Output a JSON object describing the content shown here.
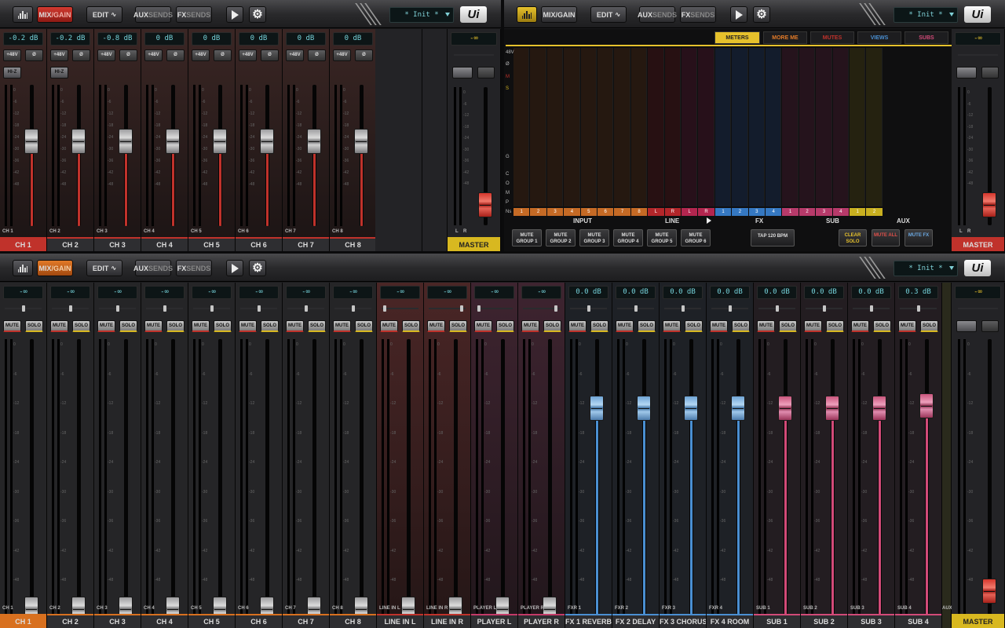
{
  "toolbar": {
    "mix_gain": [
      "MIX",
      "/GAIN"
    ],
    "edit": "EDIT",
    "aux": [
      "AUX",
      "SENDS"
    ],
    "fx": [
      "FX",
      "SENDS"
    ],
    "snapshot": "* Init *",
    "logo": "Ui"
  },
  "top_left": {
    "gains": [
      "-0.2 dB",
      "-0.2 dB",
      "-0.8 dB",
      "0 dB",
      "0 dB",
      "0 dB",
      "0 dB",
      "0 dB"
    ],
    "phantom": "+48V",
    "phase": "Ø",
    "hiz": "HI-Z",
    "channels": [
      "CH 1",
      "CH 2",
      "CH 3",
      "CH 4",
      "CH 5",
      "CH 6",
      "CH 7",
      "CH 8"
    ],
    "short": [
      "CH 1",
      "CH 2",
      "CH 3",
      "CH 4",
      "CH 5",
      "CH 6",
      "CH 7",
      "CH 8"
    ],
    "master": "MASTER",
    "master_value": "-∞",
    "lr": [
      "L",
      "R"
    ]
  },
  "scale_marks": [
    "0",
    "-6",
    "-12",
    "-18",
    "-24",
    "-30",
    "-36",
    "-42",
    "-48"
  ],
  "meters_view": {
    "tabs": [
      "METERS",
      "MORE ME",
      "MUTES",
      "VIEWS",
      "SUBS"
    ],
    "left_labels": [
      "48V",
      "Ø",
      "M",
      "S",
      "G",
      "C",
      "O",
      "M",
      "P",
      "Ns"
    ],
    "input_nums": [
      "1",
      "2",
      "3",
      "4",
      "5",
      "6",
      "7",
      "8"
    ],
    "line_nums": [
      "L",
      "R"
    ],
    "player_nums": [
      "L",
      "R"
    ],
    "fx_nums": [
      "1",
      "2",
      "3",
      "4"
    ],
    "sub_nums": [
      "1",
      "2",
      "3",
      "4"
    ],
    "aux_nums": [
      "1",
      "2"
    ],
    "group_labels": [
      "INPUT",
      "LINE",
      "FX",
      "SUB",
      "AUX"
    ],
    "mute_groups": [
      "MUTE GROUP 1",
      "MUTE GROUP 2",
      "MUTE GROUP 3",
      "MUTE GROUP 4",
      "MUTE GROUP 5",
      "MUTE GROUP 6"
    ],
    "tap": "TAP 120 BPM",
    "clear_solo": "CLEAR SOLO",
    "mute_all": "MUTE ALL",
    "mute_fx": "MUTE FX"
  },
  "bottom": {
    "channels": [
      {
        "name": "CH 1",
        "short": "CH 1",
        "value": "-∞",
        "kind": "input",
        "level": 0.0
      },
      {
        "name": "CH 2",
        "short": "CH 2",
        "value": "-∞",
        "kind": "input",
        "level": 0.0
      },
      {
        "name": "CH 3",
        "short": "CH 3",
        "value": "-∞",
        "kind": "input",
        "level": 0.0
      },
      {
        "name": "CH 4",
        "short": "CH 4",
        "value": "-∞",
        "kind": "input",
        "level": 0.0
      },
      {
        "name": "CH 5",
        "short": "CH 5",
        "value": "-∞",
        "kind": "input",
        "level": 0.0
      },
      {
        "name": "CH 6",
        "short": "CH 6",
        "value": "-∞",
        "kind": "input",
        "level": 0.0
      },
      {
        "name": "CH 7",
        "short": "CH 7",
        "value": "-∞",
        "kind": "input",
        "level": 0.0
      },
      {
        "name": "CH 8",
        "short": "CH 8",
        "value": "-∞",
        "kind": "input",
        "level": 0.0
      },
      {
        "name": "LINE IN L",
        "short": "LINE IN L",
        "value": "-∞",
        "kind": "line",
        "level": 0.0
      },
      {
        "name": "LINE IN R",
        "short": "LINE IN R",
        "value": "-∞",
        "kind": "line",
        "level": 0.0
      },
      {
        "name": "PLAYER L",
        "short": "PLAYER L",
        "value": "-∞",
        "kind": "player",
        "level": 0.0
      },
      {
        "name": "PLAYER R",
        "short": "PLAYER R",
        "value": "-∞",
        "kind": "player",
        "level": 0.0
      },
      {
        "name": "FX 1 REVERB",
        "short": "FXR 1",
        "value": "0.0 dB",
        "kind": "fx",
        "level": 0.78
      },
      {
        "name": "FX 2 DELAY",
        "short": "FXR 2",
        "value": "0.0 dB",
        "kind": "fx",
        "level": 0.78
      },
      {
        "name": "FX 3 CHORUS",
        "short": "FXR 3",
        "value": "0.0 dB",
        "kind": "fx",
        "level": 0.78
      },
      {
        "name": "FX 4 ROOM",
        "short": "FXR 4",
        "value": "0.0 dB",
        "kind": "fx",
        "level": 0.78
      },
      {
        "name": "SUB 1",
        "short": "SUB 1",
        "value": "0.0 dB",
        "kind": "sub",
        "level": 0.78
      },
      {
        "name": "SUB 2",
        "short": "SUB 2",
        "value": "0.0 dB",
        "kind": "sub",
        "level": 0.78
      },
      {
        "name": "SUB 3",
        "short": "SUB 3",
        "value": "0.0 dB",
        "kind": "sub",
        "level": 0.78
      },
      {
        "name": "SUB 4",
        "short": "SUB 4",
        "value": "0.3 dB",
        "kind": "sub",
        "level": 0.79
      }
    ],
    "mute": "MUTE",
    "solo": "SOLO",
    "master": "MASTER",
    "master_value": "-∞",
    "aux_short": "AUX"
  },
  "colors": {
    "accent_red": "#c0322b",
    "accent_orange": "#d8701f",
    "accent_yellow": "#d8b820",
    "meter_teal": "#76d3db",
    "fx_blue": "#4a8fd2",
    "sub_pink": "#d24a78"
  }
}
